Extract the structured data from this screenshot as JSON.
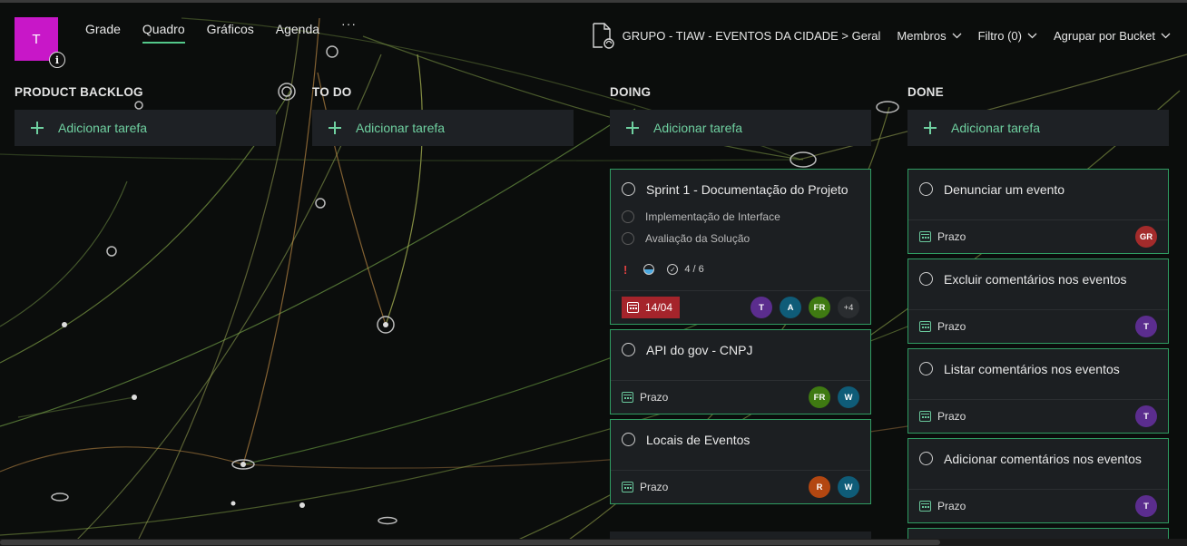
{
  "avatar_initial": "T",
  "nav": {
    "tabs": [
      "Grade",
      "Quadro",
      "Gráficos",
      "Agenda"
    ],
    "active_tab": "Quadro",
    "more": "···"
  },
  "header": {
    "group_path": "GRUPO - TIAW - EVENTOS DA CIDADE > Geral",
    "members_label": "Membros",
    "filter_label": "Filtro (0)",
    "group_by_label": "Agrupar por Bucket"
  },
  "add_task_label": "Adicionar tarefa",
  "due_label": "Prazo",
  "colors": {
    "accent": "#2f9c62",
    "add_text": "#6fd0a0",
    "late": "#a5242b",
    "avatar_tile": "#c817c8"
  },
  "columns": [
    {
      "title": "PRODUCT BACKLOG"
    },
    {
      "title": "TO DO"
    },
    {
      "title": "DOING"
    },
    {
      "title": "DONE"
    }
  ],
  "doing_cards": [
    {
      "title": "Sprint 1 - Documentação do Projeto",
      "checklist": [
        "Implementação de Interface",
        "Avaliação da Solução"
      ],
      "checklist_progress": "4 / 6",
      "due": "14/04",
      "assignees": [
        {
          "initials": "T",
          "color": "#5b2d8e"
        },
        {
          "initials": "A",
          "color": "#0f5c78"
        },
        {
          "initials": "FR",
          "color": "#3f7a12"
        }
      ],
      "extra_assignees": "+4"
    },
    {
      "title": "API do gov - CNPJ",
      "assignees": [
        {
          "initials": "FR",
          "color": "#3f7a12"
        },
        {
          "initials": "W",
          "color": "#0f5c78"
        }
      ]
    },
    {
      "title": "Locais de Eventos",
      "assignees": [
        {
          "initials": "R",
          "color": "#b34711"
        },
        {
          "initials": "W",
          "color": "#0f5c78"
        }
      ]
    }
  ],
  "done_cards": [
    {
      "title": "Denunciar um evento",
      "assignees": [
        {
          "initials": "GR",
          "color": "#a32b2b"
        }
      ]
    },
    {
      "title": "Excluir comentários nos eventos",
      "assignees": [
        {
          "initials": "T",
          "color": "#5b2d8e"
        }
      ]
    },
    {
      "title": "Listar comentários nos eventos",
      "assignees": [
        {
          "initials": "T",
          "color": "#5b2d8e"
        }
      ]
    },
    {
      "title": "Adicionar comentários nos eventos",
      "assignees": [
        {
          "initials": "T",
          "color": "#5b2d8e"
        }
      ]
    }
  ]
}
